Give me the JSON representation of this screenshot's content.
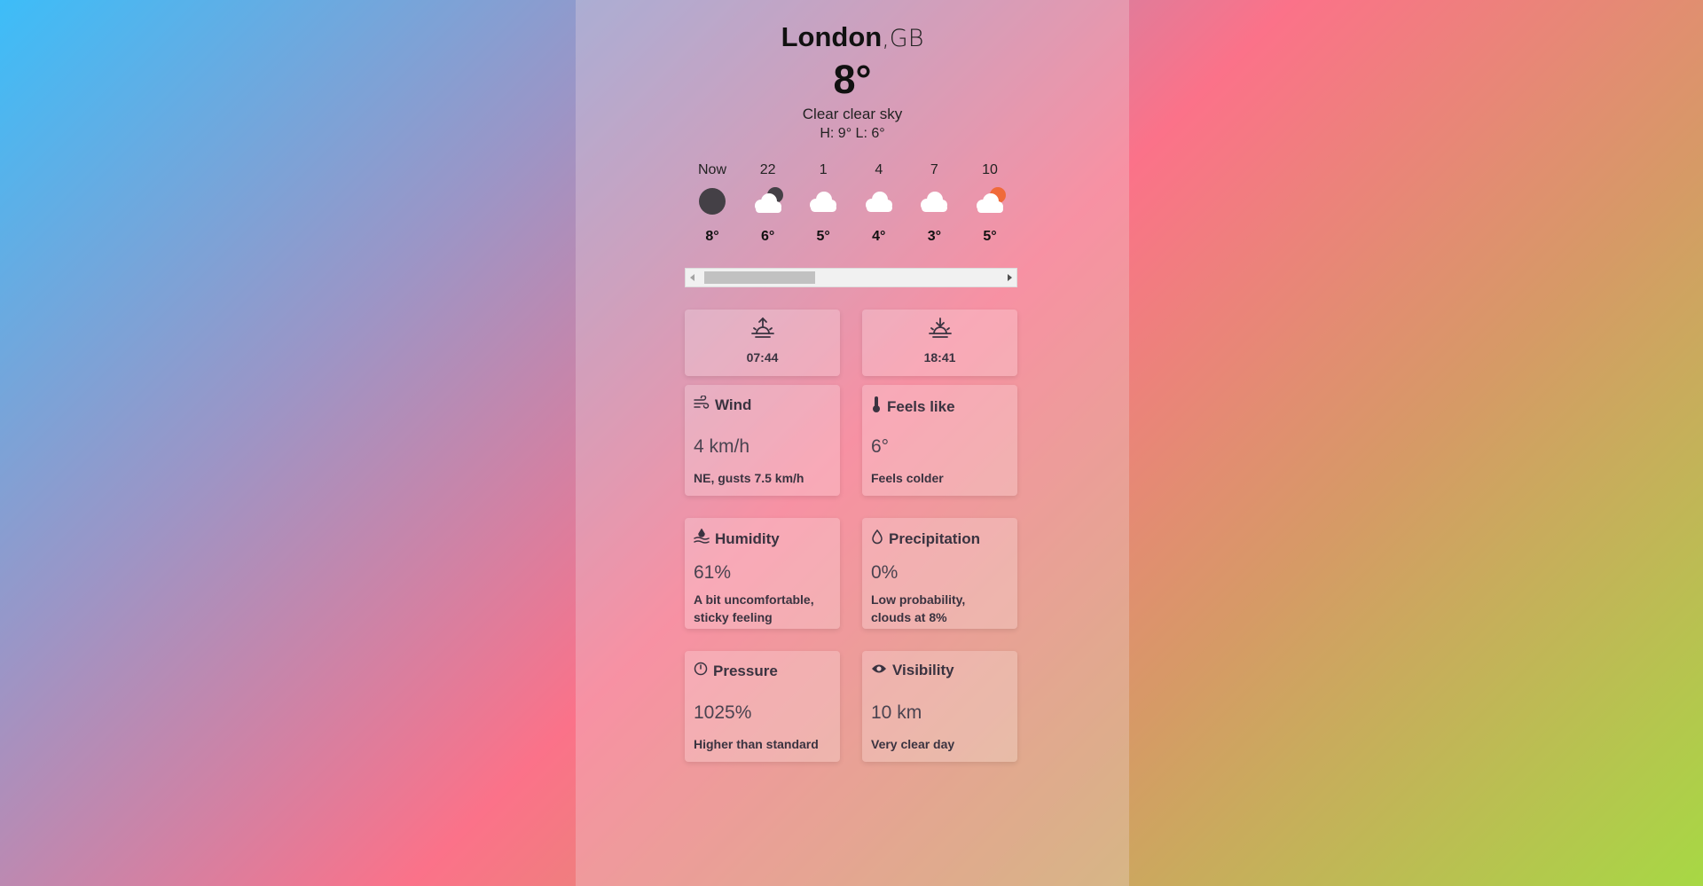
{
  "location": {
    "city": "London",
    "country": ",GB"
  },
  "current": {
    "temp": "8°",
    "description": "Clear clear sky",
    "hilo": "H: 9° L: 6°"
  },
  "hourly": [
    {
      "label": "Now",
      "icon": "moon-icon",
      "temp": "8°"
    },
    {
      "label": "22",
      "icon": "cloud-moon-icon",
      "temp": "6°"
    },
    {
      "label": "1",
      "icon": "cloud-icon",
      "temp": "5°"
    },
    {
      "label": "4",
      "icon": "cloud-icon",
      "temp": "4°"
    },
    {
      "label": "7",
      "icon": "cloud-icon",
      "temp": "3°"
    },
    {
      "label": "10",
      "icon": "cloud-sun-icon",
      "temp": "5°"
    }
  ],
  "sun": {
    "sunrise": "07:44",
    "sunset": "18:41"
  },
  "cards": {
    "wind": {
      "title": "Wind",
      "icon": "wind-icon",
      "value": "4 km/h",
      "note": "NE, gusts 7.5 km/h"
    },
    "feels_like": {
      "title": "Feels like",
      "icon": "thermometer-icon",
      "value": "6°",
      "note": "Feels colder"
    },
    "humidity": {
      "title": "Humidity",
      "icon": "humidity-icon",
      "value": "61%",
      "note": "A bit uncomfortable, sticky feeling"
    },
    "precipitation": {
      "title": "Precipitation",
      "icon": "droplet-icon",
      "value": "0%",
      "note": "Low probability, clouds at 8%"
    },
    "pressure": {
      "title": "Pressure",
      "icon": "gauge-icon",
      "value": "1025%",
      "note": "Higher than standard"
    },
    "visibility": {
      "title": "Visibility",
      "icon": "eye-icon",
      "value": "10 km",
      "note": "Very clear day"
    }
  },
  "colors": {
    "moon": "#444046",
    "sun": "#f06a3a",
    "cloud": "#ffffff",
    "gradient": [
      "#3dbdf8",
      "#9c95c6",
      "#fb7289",
      "#d69a66",
      "#a7d844"
    ]
  }
}
